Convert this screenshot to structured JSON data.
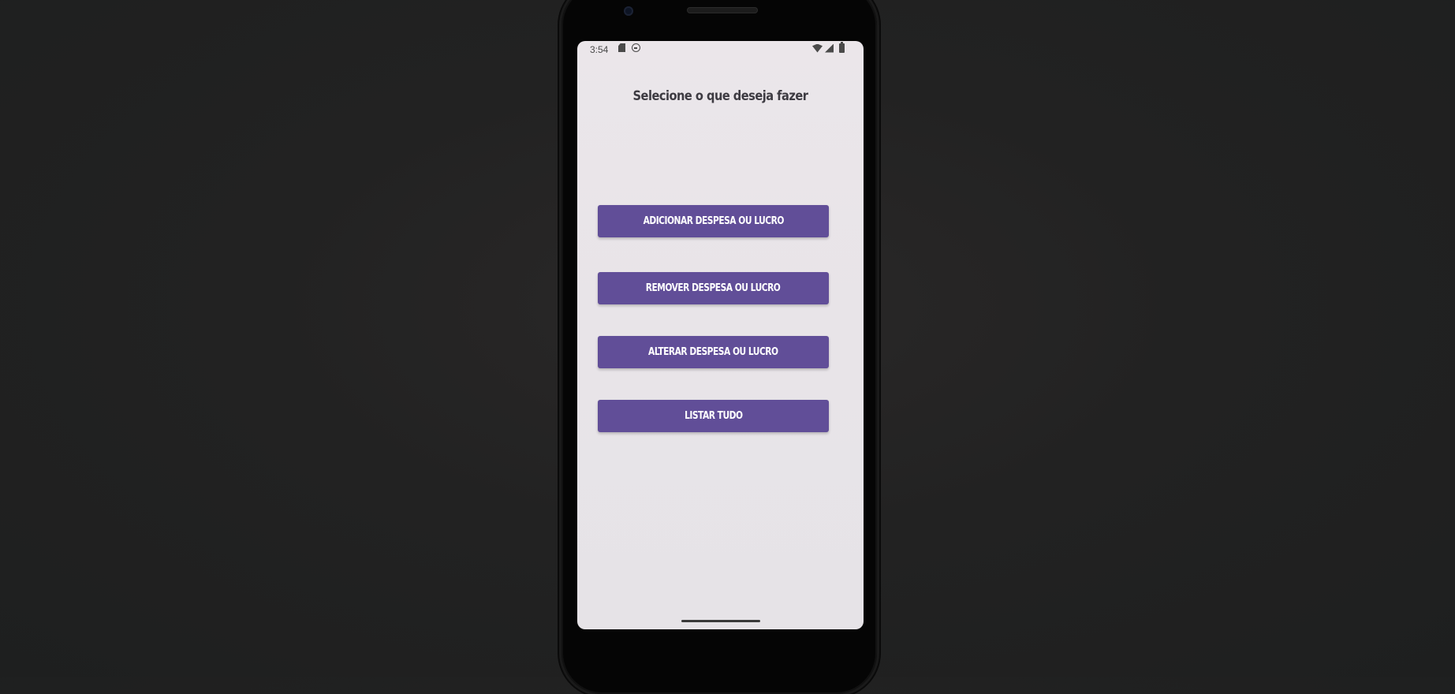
{
  "status_bar": {
    "time": "3:54",
    "left_icons": [
      "sd-card-icon",
      "face-icon"
    ],
    "right_icons": [
      "wifi-icon",
      "signal-icon",
      "battery-icon"
    ]
  },
  "main": {
    "title": "Selecione o que deseja fazer",
    "buttons": [
      {
        "label": "ADICIONAR DESPESA OU LUCRO"
      },
      {
        "label": "REMOVER DESPESA OU LUCRO"
      },
      {
        "label": "ALTERAR DESPESA OU LUCRO"
      },
      {
        "label": "LISTAR TUDO"
      }
    ]
  },
  "colors": {
    "accent": "#614e98",
    "screen_background": "#e9e5e9",
    "page_background": "#222222"
  }
}
